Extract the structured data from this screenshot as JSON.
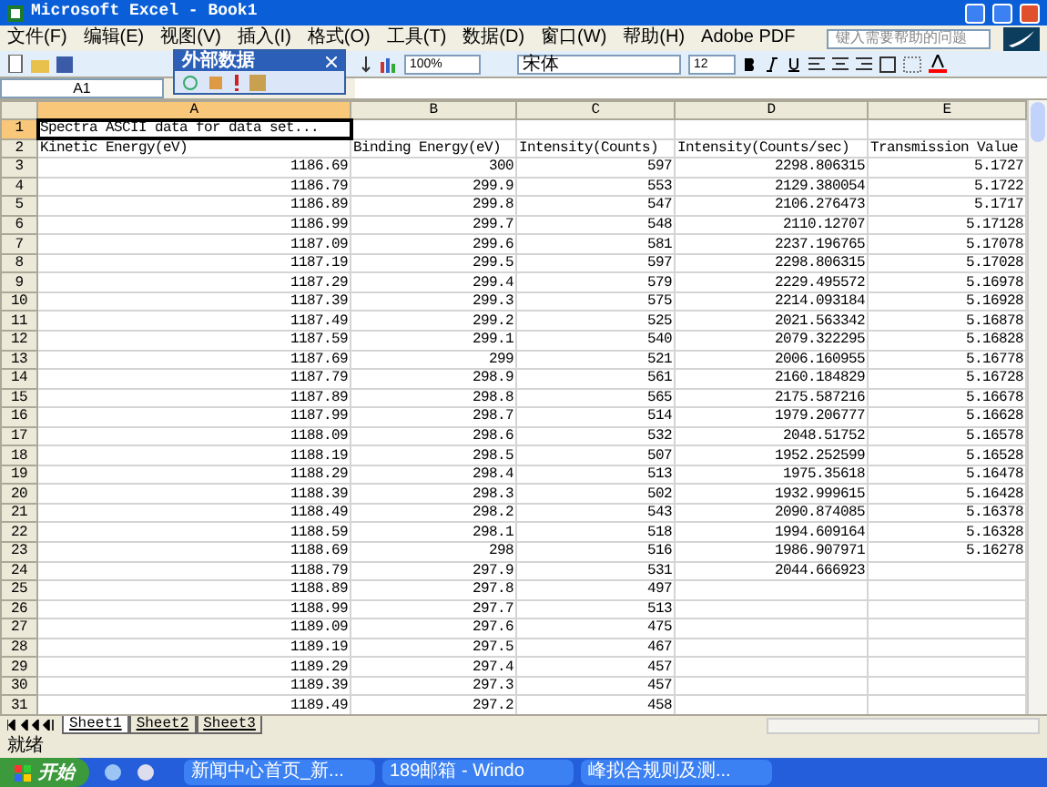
{
  "window": {
    "title": "Microsoft Excel - Book1"
  },
  "menu": [
    "文件(F)",
    "编辑(E)",
    "视图(V)",
    "插入(I)",
    "格式(O)",
    "工具(T)",
    "数据(D)",
    "窗口(W)",
    "帮助(H)",
    "Adobe PDF"
  ],
  "help_box": {
    "placeholder": "键入需要帮助的问题"
  },
  "toolbar": {
    "zoom": "100%",
    "font": "宋体",
    "font_size": "12"
  },
  "floating_toolbar": {
    "title": "外部数据"
  },
  "name_box": "A1",
  "columns": [
    "A",
    "B",
    "C",
    "D",
    "E"
  ],
  "rows": [
    {
      "n": "1",
      "cells": [
        "Spectra ASCII data for data set...",
        "",
        "",
        "",
        ""
      ],
      "selected": true
    },
    {
      "n": "2",
      "cells": [
        "Kinetic Energy(eV)",
        "Binding Energy(eV)",
        "Intensity(Counts)",
        "Intensity(Counts/sec)",
        "Transmission Value"
      ],
      "selected": false
    },
    {
      "n": "3",
      "cells": [
        "1186.69",
        "300",
        "597",
        "2298.806315",
        "5.1727"
      ],
      "selected": false
    },
    {
      "n": "4",
      "cells": [
        "1186.79",
        "299.9",
        "553",
        "2129.380054",
        "5.1722"
      ],
      "selected": false
    },
    {
      "n": "5",
      "cells": [
        "1186.89",
        "299.8",
        "547",
        "2106.276473",
        "5.1717"
      ],
      "selected": false
    },
    {
      "n": "6",
      "cells": [
        "1186.99",
        "299.7",
        "548",
        "2110.12707",
        "5.17128"
      ],
      "selected": false
    },
    {
      "n": "7",
      "cells": [
        "1187.09",
        "299.6",
        "581",
        "2237.196765",
        "5.17078"
      ],
      "selected": false
    },
    {
      "n": "8",
      "cells": [
        "1187.19",
        "299.5",
        "597",
        "2298.806315",
        "5.17028"
      ],
      "selected": false
    },
    {
      "n": "9",
      "cells": [
        "1187.29",
        "299.4",
        "579",
        "2229.495572",
        "5.16978"
      ],
      "selected": false
    },
    {
      "n": "10",
      "cells": [
        "1187.39",
        "299.3",
        "575",
        "2214.093184",
        "5.16928"
      ],
      "selected": false
    },
    {
      "n": "11",
      "cells": [
        "1187.49",
        "299.2",
        "525",
        "2021.563342",
        "5.16878"
      ],
      "selected": false
    },
    {
      "n": "12",
      "cells": [
        "1187.59",
        "299.1",
        "540",
        "2079.322295",
        "5.16828"
      ],
      "selected": false
    },
    {
      "n": "13",
      "cells": [
        "1187.69",
        "299",
        "521",
        "2006.160955",
        "5.16778"
      ],
      "selected": false
    },
    {
      "n": "14",
      "cells": [
        "1187.79",
        "298.9",
        "561",
        "2160.184829",
        "5.16728"
      ],
      "selected": false
    },
    {
      "n": "15",
      "cells": [
        "1187.89",
        "298.8",
        "565",
        "2175.587216",
        "5.16678"
      ],
      "selected": false
    },
    {
      "n": "16",
      "cells": [
        "1187.99",
        "298.7",
        "514",
        "1979.206777",
        "5.16628"
      ],
      "selected": false
    },
    {
      "n": "17",
      "cells": [
        "1188.09",
        "298.6",
        "532",
        "2048.51752",
        "5.16578"
      ],
      "selected": false
    },
    {
      "n": "18",
      "cells": [
        "1188.19",
        "298.5",
        "507",
        "1952.252599",
        "5.16528"
      ],
      "selected": false
    },
    {
      "n": "19",
      "cells": [
        "1188.29",
        "298.4",
        "513",
        "1975.35618",
        "5.16478"
      ],
      "selected": false
    },
    {
      "n": "20",
      "cells": [
        "1188.39",
        "298.3",
        "502",
        "1932.999615",
        "5.16428"
      ],
      "selected": false
    },
    {
      "n": "21",
      "cells": [
        "1188.49",
        "298.2",
        "543",
        "2090.874085",
        "5.16378"
      ],
      "selected": false
    },
    {
      "n": "22",
      "cells": [
        "1188.59",
        "298.1",
        "518",
        "1994.609164",
        "5.16328"
      ],
      "selected": false
    },
    {
      "n": "23",
      "cells": [
        "1188.69",
        "298",
        "516",
        "1986.907971",
        "5.16278"
      ],
      "selected": false
    },
    {
      "n": "24",
      "cells": [
        "1188.79",
        "297.9",
        "531",
        "2044.666923",
        ""
      ],
      "selected": false
    },
    {
      "n": "25",
      "cells": [
        "1188.89",
        "297.8",
        "497",
        "",
        ""
      ],
      "selected": false
    },
    {
      "n": "26",
      "cells": [
        "1188.99",
        "297.7",
        "513",
        "",
        ""
      ],
      "selected": false
    },
    {
      "n": "27",
      "cells": [
        "1189.09",
        "297.6",
        "475",
        "",
        ""
      ],
      "selected": false
    },
    {
      "n": "28",
      "cells": [
        "1189.19",
        "297.5",
        "467",
        "",
        ""
      ],
      "selected": false
    },
    {
      "n": "29",
      "cells": [
        "1189.29",
        "297.4",
        "457",
        "",
        ""
      ],
      "selected": false
    },
    {
      "n": "30",
      "cells": [
        "1189.39",
        "297.3",
        "457",
        "",
        ""
      ],
      "selected": false
    },
    {
      "n": "31",
      "cells": [
        "1189.49",
        "297.2",
        "458",
        "",
        ""
      ],
      "selected": false
    }
  ],
  "sheet_tabs": [
    {
      "label": "Sheet1",
      "selected": true
    },
    {
      "label": "Sheet2",
      "selected": false
    },
    {
      "label": "Sheet3",
      "selected": false
    }
  ],
  "status_bar": "就绪",
  "taskbar": {
    "start": "开始",
    "tasks": [
      "新闻中心首页_新...",
      "189邮箱 - Windo",
      "峰拟合规则及测..."
    ]
  }
}
